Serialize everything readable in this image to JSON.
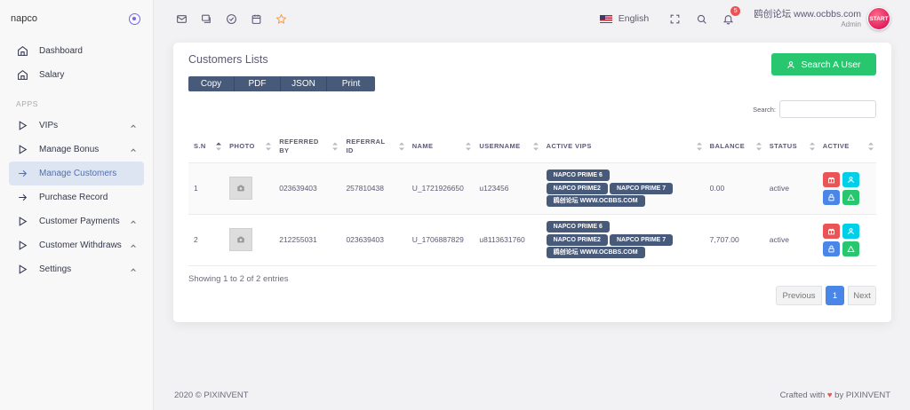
{
  "sidebar": {
    "brand": "napco",
    "items_top": [
      {
        "label": "Dashboard",
        "icon": "home-icon"
      },
      {
        "label": "Salary",
        "icon": "home-icon"
      }
    ],
    "section_label": "APPS",
    "items": [
      {
        "label": "VIPs",
        "icon": "play-icon",
        "chevron": true
      },
      {
        "label": "Manage Bonus",
        "icon": "play-icon",
        "chevron": true
      },
      {
        "label": "Manage Customers",
        "icon": "arrow-right-icon",
        "active": true
      },
      {
        "label": "Purchase Record",
        "icon": "arrow-right-icon"
      },
      {
        "label": "Customer Payments",
        "icon": "play-icon",
        "chevron": true
      },
      {
        "label": "Customer Withdraws",
        "icon": "play-icon",
        "chevron": true
      },
      {
        "label": "Settings",
        "icon": "play-icon",
        "chevron": true
      }
    ]
  },
  "header": {
    "language": "English",
    "notification_count": "5",
    "user_name": "鸥创论坛 www.ocbbs.com",
    "user_role": "Admin",
    "avatar_text": "START"
  },
  "card": {
    "title": "Customers Lists",
    "export_buttons": [
      "Copy",
      "PDF",
      "JSON",
      "Print"
    ],
    "search_user_label": "Search A User",
    "search_label": "Search:",
    "search_value": "",
    "columns": [
      "S.N",
      "PHOTO",
      "REFERRED BY",
      "REFERRAL ID",
      "NAME",
      "USERNAME",
      "ACTIVE VIPS",
      "BALANCE",
      "STATUS",
      "ACTIVE"
    ],
    "rows": [
      {
        "sn": "1",
        "referred_by": "023639403",
        "referral_id": "257810438",
        "name": "U_1721926650",
        "username": "u123456",
        "vips": [
          "NAPCO PRIME 6",
          "NAPCO PRIME2",
          "NAPCO PRIME 7",
          "鸥创论坛 WWW.OCBBS.COM"
        ],
        "balance": "0.00",
        "status": "active"
      },
      {
        "sn": "2",
        "referred_by": "212255031",
        "referral_id": "023639403",
        "name": "U_1706887829",
        "username": "u8113631760",
        "vips": [
          "NAPCO PRIME 6",
          "NAPCO PRIME2",
          "NAPCO PRIME 7",
          "鸥创论坛 WWW.OCBBS.COM"
        ],
        "balance": "7,707.00",
        "status": "active"
      }
    ],
    "info": "Showing 1 to 2 of 2 entries",
    "pager": {
      "prev": "Previous",
      "current": "1",
      "next": "Next"
    }
  },
  "footer": {
    "copyright": "2020 © PIXINVENT",
    "crafted_prefix": "Crafted with",
    "heart": "♥",
    "crafted_suffix": "by PIXINVENT"
  },
  "colors": {
    "primary": "#7367f0",
    "success": "#28c76f",
    "danger": "#ea5455",
    "info": "#00cfe8",
    "vip_badge": "#485a7a",
    "pager_active": "#4a86e8"
  }
}
